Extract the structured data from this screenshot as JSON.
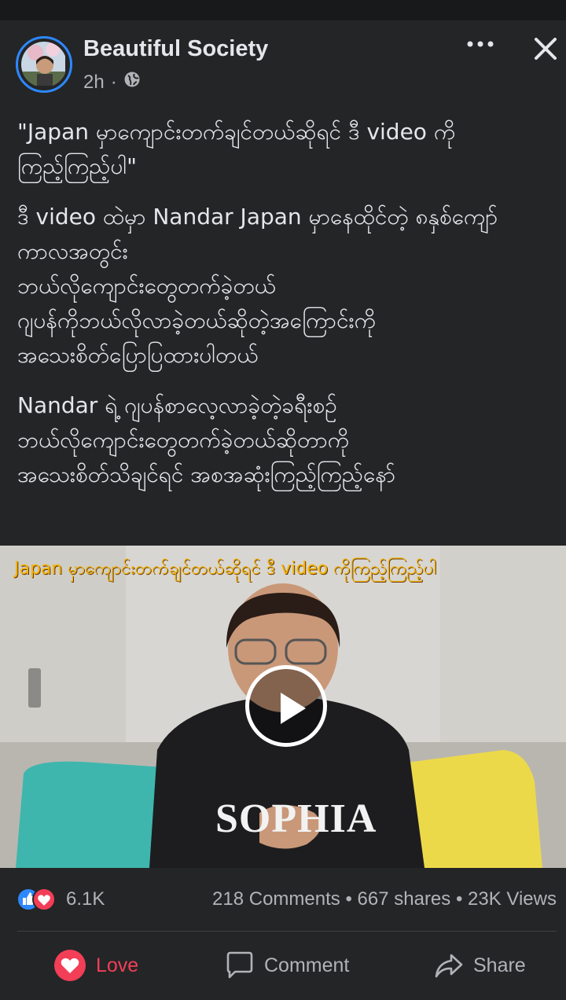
{
  "post": {
    "page_name": "Beautiful Society",
    "time_ago": "2h",
    "separator": "·",
    "audience_icon": "globe-icon",
    "paragraphs": [
      "\"Japan မှာကျောင်းတက်ချင်တယ်ဆိုရင် ဒီ video ကို\nကြည့်ကြည့်ပါ\"",
      "ဒီ video ထဲမှာ Nandar Japan မှာနေထိုင်တဲ့ ၈နှစ်ကျော်\nကာလအတွင်း\nဘယ်လိုကျောင်းတွေတက်ခဲ့တယ်\nဂျပန်ကိုဘယ်လိုလာခဲ့တယ်ဆိုတဲ့အကြောင်းကို\nအသေးစိတ်ပြောပြထားပါတယ်",
      "Nandar ရဲ့ ဂျပန်စာလေ့လာခဲ့တဲ့ခရီးစဉ်\nဘယ်လိုကျောင်းတွေတက်ခဲ့တယ်ဆိုတာကို\nအသေးစိတ်သိချင်ရင် အစအဆုံးကြည့်ကြည့်နော်"
    ],
    "video": {
      "caption": "Japan မှာကျောင်းတက်ချင်တယ်ဆိုရင် ဒီ video ကိုကြည့်ကြည့်ပါ",
      "shirt_text": "SOPHIA"
    }
  },
  "stats": {
    "reaction_count": "6.1K",
    "comments": "218 Comments",
    "shares": "667 shares",
    "views": "23K Views",
    "dot": "•"
  },
  "actions": {
    "love_label": "Love",
    "comment_label": "Comment",
    "share_label": "Share"
  },
  "colors": {
    "background": "#242526",
    "text": "#e4e6eb",
    "secondary_text": "#b0b3b8",
    "love": "#f33e58",
    "like": "#2d88ff",
    "caption": "#f5b400"
  }
}
